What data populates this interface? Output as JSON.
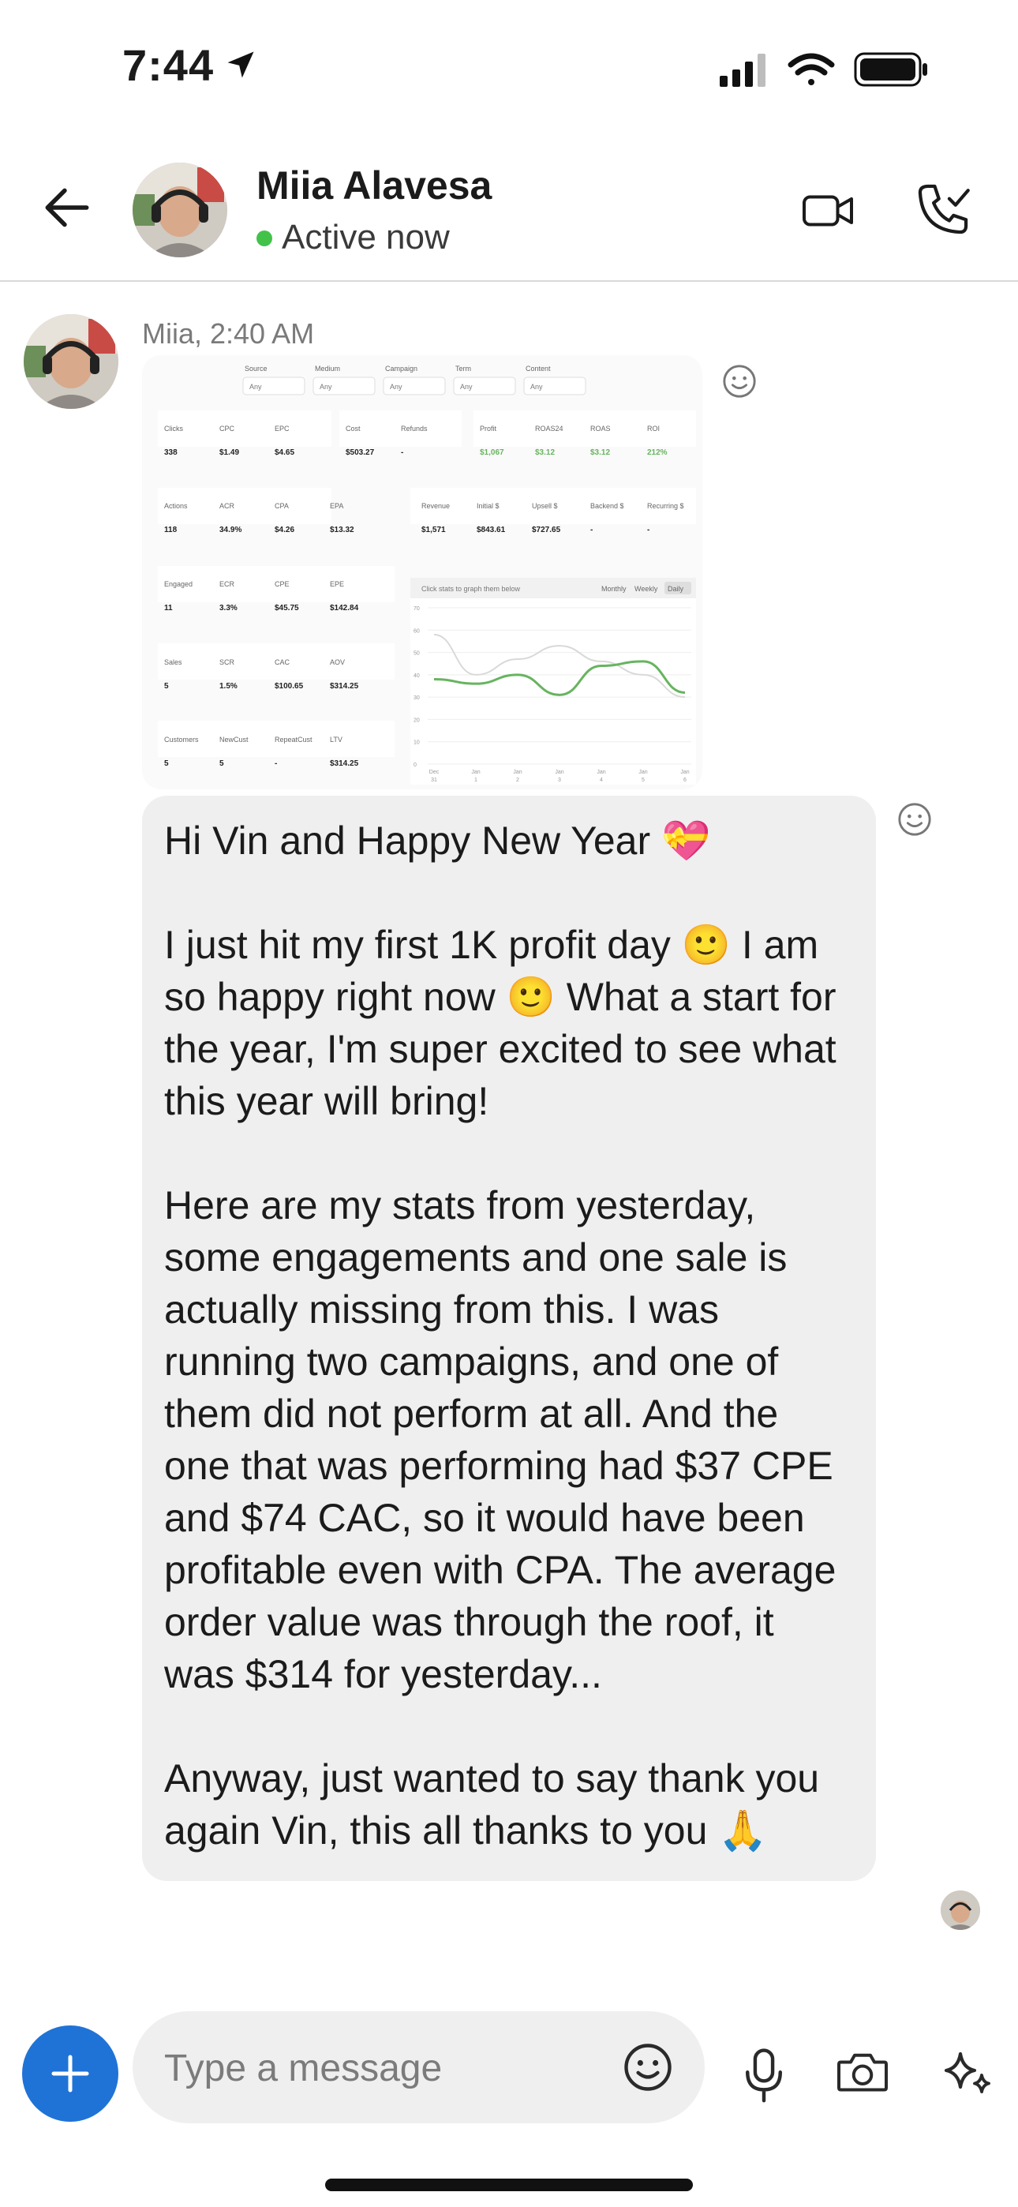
{
  "status_bar": {
    "time": "7:44",
    "location_icon": "location-arrow-icon",
    "signal_icon": "cellular-signal-icon",
    "wifi_icon": "wifi-icon",
    "battery_icon": "battery-icon"
  },
  "header": {
    "back_icon": "back-arrow-icon",
    "contact_name": "Miia Alavesa",
    "presence": "Active now",
    "presence_color": "#43c24a",
    "video_icon": "video-call-icon",
    "call_icon": "phone-call-icon"
  },
  "message": {
    "meta": "Miia, 2:40 AM",
    "attachment": {
      "filters": [
        "Source",
        "Medium",
        "Campaign",
        "Term",
        "Content"
      ],
      "filter_value": "Any",
      "row1": [
        {
          "label": "Clicks",
          "value": "338"
        },
        {
          "label": "CPC",
          "value": "$1.49"
        },
        {
          "label": "EPC",
          "value": "$4.65"
        },
        {
          "label": "Cost",
          "value": "$503.27"
        },
        {
          "label": "Refunds",
          "value": "-"
        },
        {
          "label": "Profit",
          "value": "$1,067"
        },
        {
          "label": "ROAS24",
          "value": "$3.12"
        },
        {
          "label": "ROAS",
          "value": "$3.12"
        },
        {
          "label": "ROI",
          "value": "212%"
        }
      ],
      "row2": [
        {
          "label": "Actions",
          "value": "118"
        },
        {
          "label": "ACR",
          "value": "34.9%"
        },
        {
          "label": "CPA",
          "value": "$4.26"
        },
        {
          "label": "EPA",
          "value": "$13.32"
        },
        {
          "label": "Revenue",
          "value": "$1,571"
        },
        {
          "label": "Initial $",
          "value": "$843.61"
        },
        {
          "label": "Upsell $",
          "value": "$727.65"
        },
        {
          "label": "Backend $",
          "value": "-"
        },
        {
          "label": "Recurring $",
          "value": "-"
        }
      ],
      "row3": [
        {
          "label": "Engaged",
          "value": "11"
        },
        {
          "label": "ECR",
          "value": "3.3%"
        },
        {
          "label": "CPE",
          "value": "$45.75"
        },
        {
          "label": "EPE",
          "value": "$142.84"
        }
      ],
      "row4": [
        {
          "label": "Sales",
          "value": "5"
        },
        {
          "label": "SCR",
          "value": "1.5%"
        },
        {
          "label": "CAC",
          "value": "$100.65"
        },
        {
          "label": "AOV",
          "value": "$314.25"
        }
      ],
      "row5": [
        {
          "label": "Customers",
          "value": "5"
        },
        {
          "label": "NewCust",
          "value": "5"
        },
        {
          "label": "RepeatCust",
          "value": "-"
        },
        {
          "label": "LTV",
          "value": "$314.25"
        }
      ],
      "graph": {
        "hint": "Click stats to graph them below",
        "periods": [
          "Monthly",
          "Weekly",
          "Daily"
        ],
        "y_ticks": [
          "70",
          "60",
          "50",
          "40",
          "30",
          "20",
          "10",
          "0"
        ],
        "x_ticks": [
          "Dec 31",
          "Jan 1",
          "Jan 2",
          "Jan 3",
          "Jan 4",
          "Jan 5",
          "Jan 6"
        ],
        "series_a": [
          38,
          36,
          40,
          31,
          44,
          46,
          32
        ],
        "series_b": [
          58,
          40,
          47,
          53,
          46,
          40,
          30
        ],
        "series_a_color": "#67b45f",
        "series_b_color": "#d9d9d9"
      }
    },
    "paragraphs": [
      "Hi Vin and Happy New Year 💝",
      "I just hit my first 1K profit day 🙂 I am\nso happy right now 🙂 What a start for\nthe year, I'm super excited to see what\nthis year will bring!",
      "Here are my stats from yesterday,\nsome engagements and one sale is\nactually missing from this. I was\nrunning two campaigns, and one of\nthem did not perform at all. And the\none that was performing had $37 CPE\nand $74 CAC, so it would have been\nprofitable even with CPA. The average\norder value was through the roof, it\nwas $314 for yesterday...",
      "Anyway, just wanted to say thank you\nagain Vin, this all thanks to you 🙏"
    ]
  },
  "composer": {
    "placeholder": "Type a message",
    "add_icon": "plus-icon",
    "emoji_icon": "emoji-icon",
    "mic_icon": "microphone-icon",
    "camera_icon": "camera-icon",
    "ai_icon": "sparkle-icon",
    "accent": "#1f73d6"
  }
}
